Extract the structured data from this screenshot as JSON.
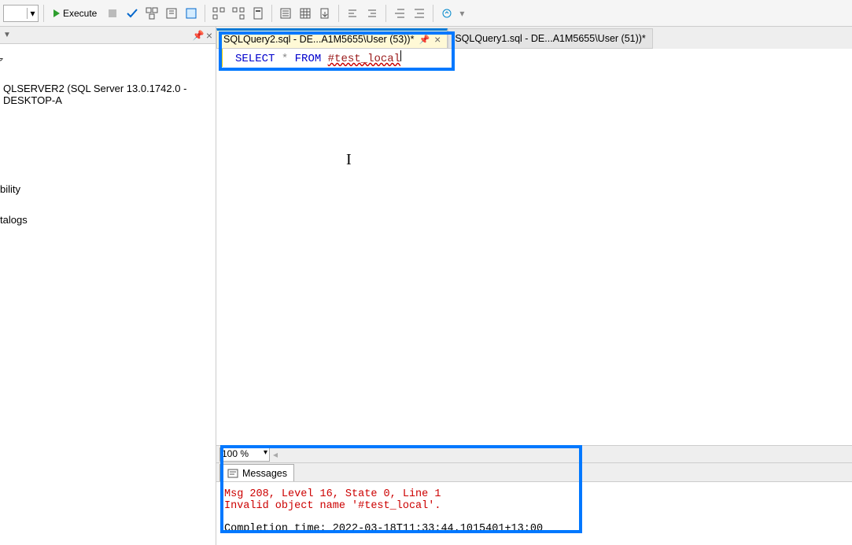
{
  "toolbar": {
    "execute_label": "Execute"
  },
  "sidebar": {
    "server_label": "QLSERVER2 (SQL Server 13.0.1742.0 - DESKTOP-A",
    "item_availability": "bility",
    "item_catalogs": "talogs"
  },
  "tabs": {
    "active": "SQLQuery2.sql - DE...A1M5655\\User (53))*",
    "inactive": "SQLQuery1.sql - DE...A1M5655\\User (51))*"
  },
  "editor": {
    "sql_select": "SELECT",
    "sql_star": "*",
    "sql_from": "FROM",
    "sql_object": "#test_local"
  },
  "zoom": {
    "value": "100 %"
  },
  "results": {
    "tab_label": "Messages",
    "error_line1": "Msg 208, Level 16, State 0, Line 1",
    "error_line2": "Invalid object name '#test_local'.",
    "completion": "Completion time: 2022-03-18T11:33:44.1015401+13:00"
  }
}
